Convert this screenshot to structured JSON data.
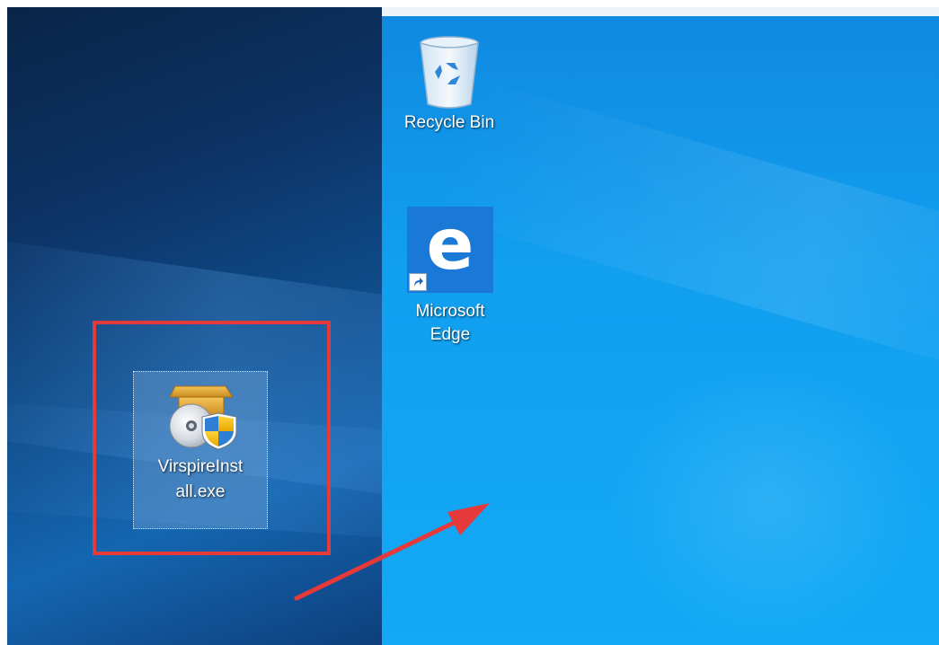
{
  "desktop": {
    "icons": [
      {
        "label": "Recycle Bin",
        "icon": "recycle-bin-icon"
      },
      {
        "label_line1": "Microsoft",
        "label_line2": "Edge",
        "icon": "edge-icon",
        "shortcut": true
      },
      {
        "label_line1": "VirspireInst",
        "label_line2": "all.exe",
        "icon": "installer-icon",
        "selected": true
      }
    ]
  },
  "annotation": {
    "highlight_color": "#e5393a",
    "arrow_color": "#e5393a"
  },
  "colors": {
    "left_wallpaper": "#0c3466",
    "right_wallpaper": "#119ff0",
    "edge_tile": "#1a78d6"
  }
}
